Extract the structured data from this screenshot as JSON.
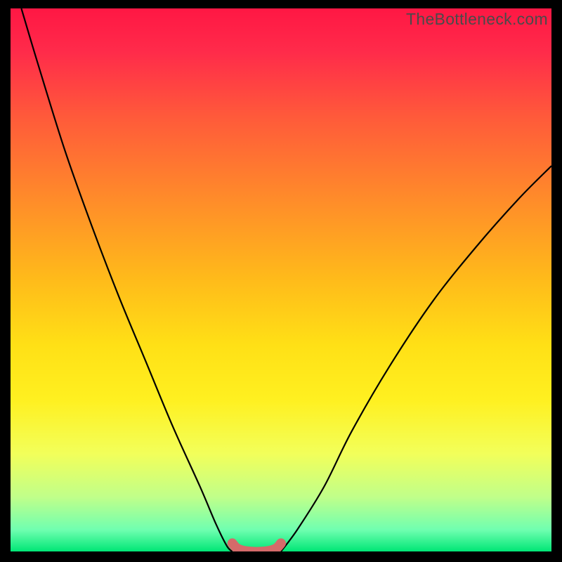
{
  "watermark": "TheBottleneck.com",
  "chart_data": {
    "type": "line",
    "title": "",
    "xlabel": "",
    "ylabel": "",
    "xlim": [
      0,
      100
    ],
    "ylim": [
      0,
      100
    ],
    "grid": false,
    "series": [
      {
        "name": "left-curve",
        "x": [
          2,
          5,
          10,
          15,
          20,
          25,
          30,
          35,
          38,
          40,
          41
        ],
        "y": [
          100,
          90,
          74,
          60,
          47,
          35,
          23,
          12,
          5,
          1,
          0
        ]
      },
      {
        "name": "right-curve",
        "x": [
          50,
          53,
          58,
          63,
          70,
          78,
          86,
          94,
          100
        ],
        "y": [
          0,
          4,
          12,
          22,
          34,
          46,
          56,
          65,
          71
        ]
      },
      {
        "name": "bottom-highlight",
        "x": [
          41,
          42,
          44,
          47,
          49,
          50
        ],
        "y": [
          1.5,
          0.5,
          0,
          0,
          0.5,
          1.5
        ]
      }
    ],
    "background_gradient": {
      "stops": [
        {
          "offset": 0.0,
          "color": "#ff1744"
        },
        {
          "offset": 0.08,
          "color": "#ff2b4a"
        },
        {
          "offset": 0.2,
          "color": "#ff5a3a"
        },
        {
          "offset": 0.35,
          "color": "#ff8b2a"
        },
        {
          "offset": 0.5,
          "color": "#ffbb1a"
        },
        {
          "offset": 0.62,
          "color": "#ffe016"
        },
        {
          "offset": 0.72,
          "color": "#fff020"
        },
        {
          "offset": 0.82,
          "color": "#f2ff5a"
        },
        {
          "offset": 0.9,
          "color": "#c0ff8a"
        },
        {
          "offset": 0.96,
          "color": "#70ffb0"
        },
        {
          "offset": 1.0,
          "color": "#00e676"
        }
      ]
    },
    "highlight_color": "#d56a6a"
  }
}
